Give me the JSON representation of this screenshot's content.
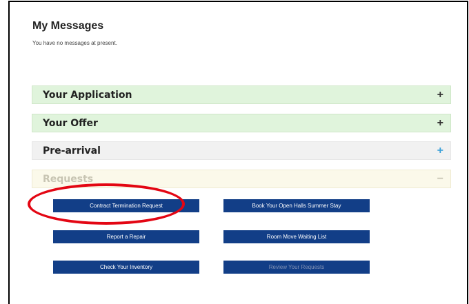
{
  "messages": {
    "title": "My Messages",
    "empty_text": "You have no messages at present."
  },
  "panels": [
    {
      "label": "Your Application",
      "toggle": "+"
    },
    {
      "label": "Your Offer",
      "toggle": "+"
    },
    {
      "label": "Pre-arrival",
      "toggle": "+"
    },
    {
      "label": "Requests",
      "toggle": "−"
    }
  ],
  "requests": {
    "buttons": [
      {
        "label": "Contract Termination Request"
      },
      {
        "label": "Book Your Open Halls Summer Stay"
      },
      {
        "label": "Report a Repair"
      },
      {
        "label": "Room Move Waiting List"
      },
      {
        "label": "Check Your Inventory"
      },
      {
        "label": "Review Your Requests"
      }
    ]
  },
  "colors": {
    "button_bg": "#123e87",
    "panel_green": "#e0f4dc",
    "panel_grey": "#f1f1f1",
    "panel_cream": "#fbf9ea",
    "highlight_ring": "#e30613",
    "plus_blue": "#3aa0d9"
  }
}
